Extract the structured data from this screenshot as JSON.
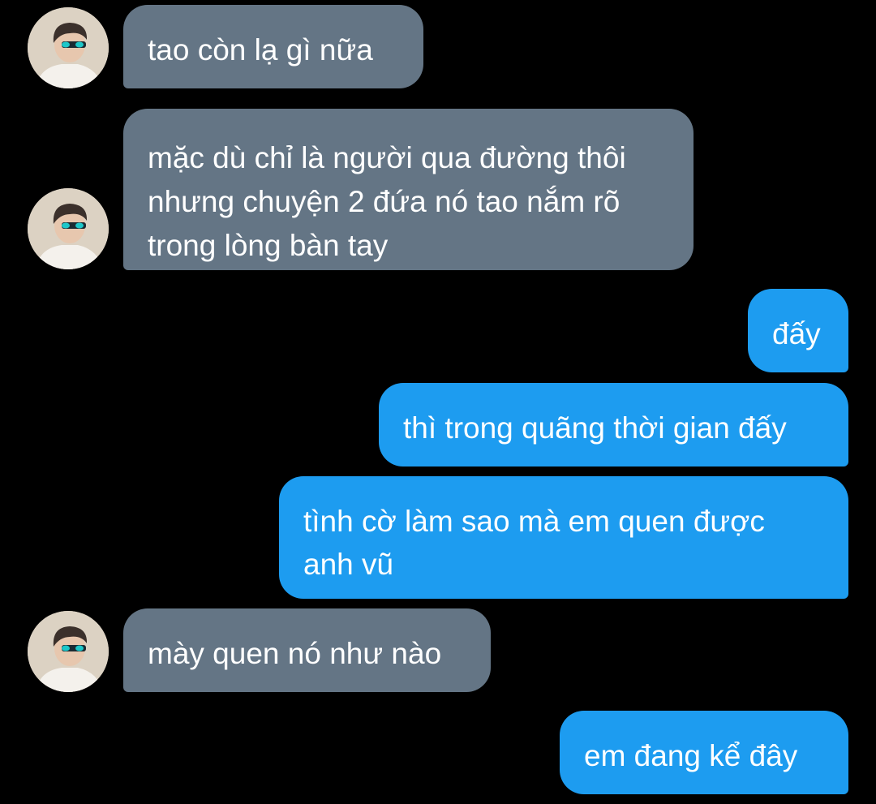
{
  "colors": {
    "background": "#000000",
    "received_bubble": "#647585",
    "sent_bubble": "#1d9cf0",
    "text": "#ffffff"
  },
  "messages": [
    {
      "sender": "other",
      "text": "tao còn lạ gì nữa"
    },
    {
      "sender": "other",
      "text": "mặc dù chỉ là người qua đường thôi\nnhưng chuyện 2 đứa nó tao nắm rõ\ntrong lòng bàn tay"
    },
    {
      "sender": "me",
      "text": "đấy"
    },
    {
      "sender": "me",
      "text": "thì trong quãng thời gian đấy"
    },
    {
      "sender": "me",
      "text": "tình cờ làm sao mà em quen được\nanh vũ"
    },
    {
      "sender": "other",
      "text": "mày quen nó như nào"
    },
    {
      "sender": "me",
      "text": "em đang kể đây"
    }
  ]
}
